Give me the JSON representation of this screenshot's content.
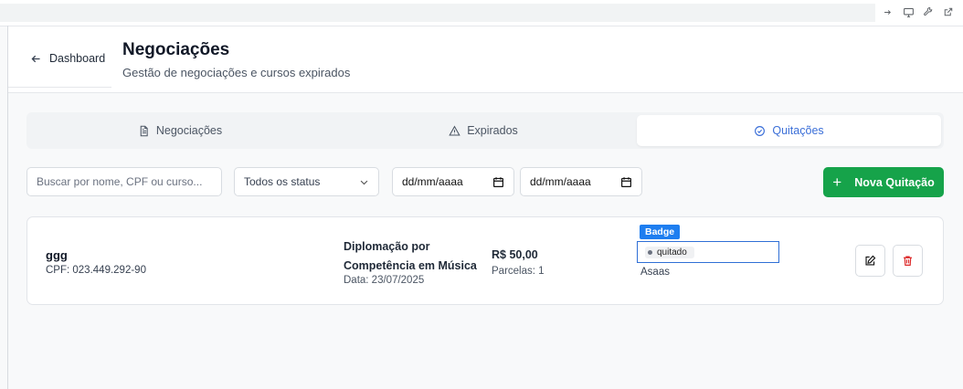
{
  "header": {
    "back_label": "Dashboard",
    "title": "Negociações",
    "subtitle": "Gestão de negociações e cursos expirados"
  },
  "tabs": [
    {
      "label": "Negociações",
      "icon": "file-text-icon",
      "active": false
    },
    {
      "label": "Expirados",
      "icon": "alert-triangle-icon",
      "active": false
    },
    {
      "label": "Quitações",
      "icon": "check-circle-icon",
      "active": true
    }
  ],
  "filters": {
    "search_placeholder": "Buscar por nome, CPF ou curso...",
    "status_value": "Todos os status",
    "date_from_value": "dd/mm/aaaa",
    "date_to_value": "dd/mm/aaaa",
    "new_button_label": "Nova Quitação"
  },
  "records": [
    {
      "name": "ggg",
      "cpf": "CPF: 023.449.292-90",
      "course": "Diplomação por Competência em Música",
      "date": "Data: 23/07/2025",
      "amount": "R$ 50,00",
      "installments": "Parcelas: 1",
      "badge_tag": "Badge",
      "status": "quitado",
      "gateway": "Asaas"
    }
  ],
  "colors": {
    "accent_blue": "#3b6fd8",
    "primary_green": "#16a34a",
    "badge_blue": "#1e7ef0",
    "danger_red": "#dc2626"
  }
}
